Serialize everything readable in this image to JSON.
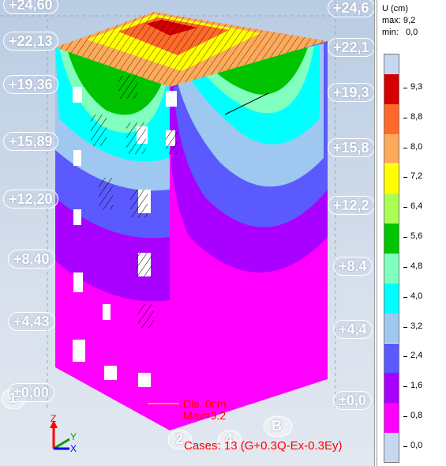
{
  "view": {
    "level_labels_left": [
      "+24,60",
      "+22,13",
      "+19,36",
      "+15,89",
      "+12,20",
      "+8,40",
      "+4,43",
      "±0,00"
    ],
    "level_labels_right": [
      "+24,6",
      "+22,1",
      "+19,3",
      "+15,8",
      "+12,2",
      "+8,4",
      "+4,4",
      "±0,0"
    ],
    "grid_axes": [
      "1",
      "2",
      "4",
      "B"
    ],
    "triad": {
      "z": "Z",
      "y": "Y",
      "x": "X"
    },
    "dis_label": "Dis. 0cm",
    "max_label": "Max=9.2",
    "cases_label": "Cases: 13 (G+0.3Q-Ex-0.3Ey)"
  },
  "legend_panel": {
    "title": "U (cm)",
    "max_row": "max: 9,2",
    "min_row": "min:   0,0",
    "ticks": [
      "9,3",
      "8,8",
      "8,0",
      "7,2",
      "6,4",
      "5,6",
      "4,8",
      "4,0",
      "3,2",
      "2,4",
      "1,6",
      "0,8",
      "0,0"
    ],
    "colors": [
      "#c5d8f0",
      "#d40000",
      "#ff6a2a",
      "#ffaa5a",
      "#ffff00",
      "#aaff55",
      "#00c400",
      "#80ffbe",
      "#00ffff",
      "#9ec8f0",
      "#5a5aff",
      "#aa00ff",
      "#ff00ff",
      "#c5d8f0"
    ]
  }
}
